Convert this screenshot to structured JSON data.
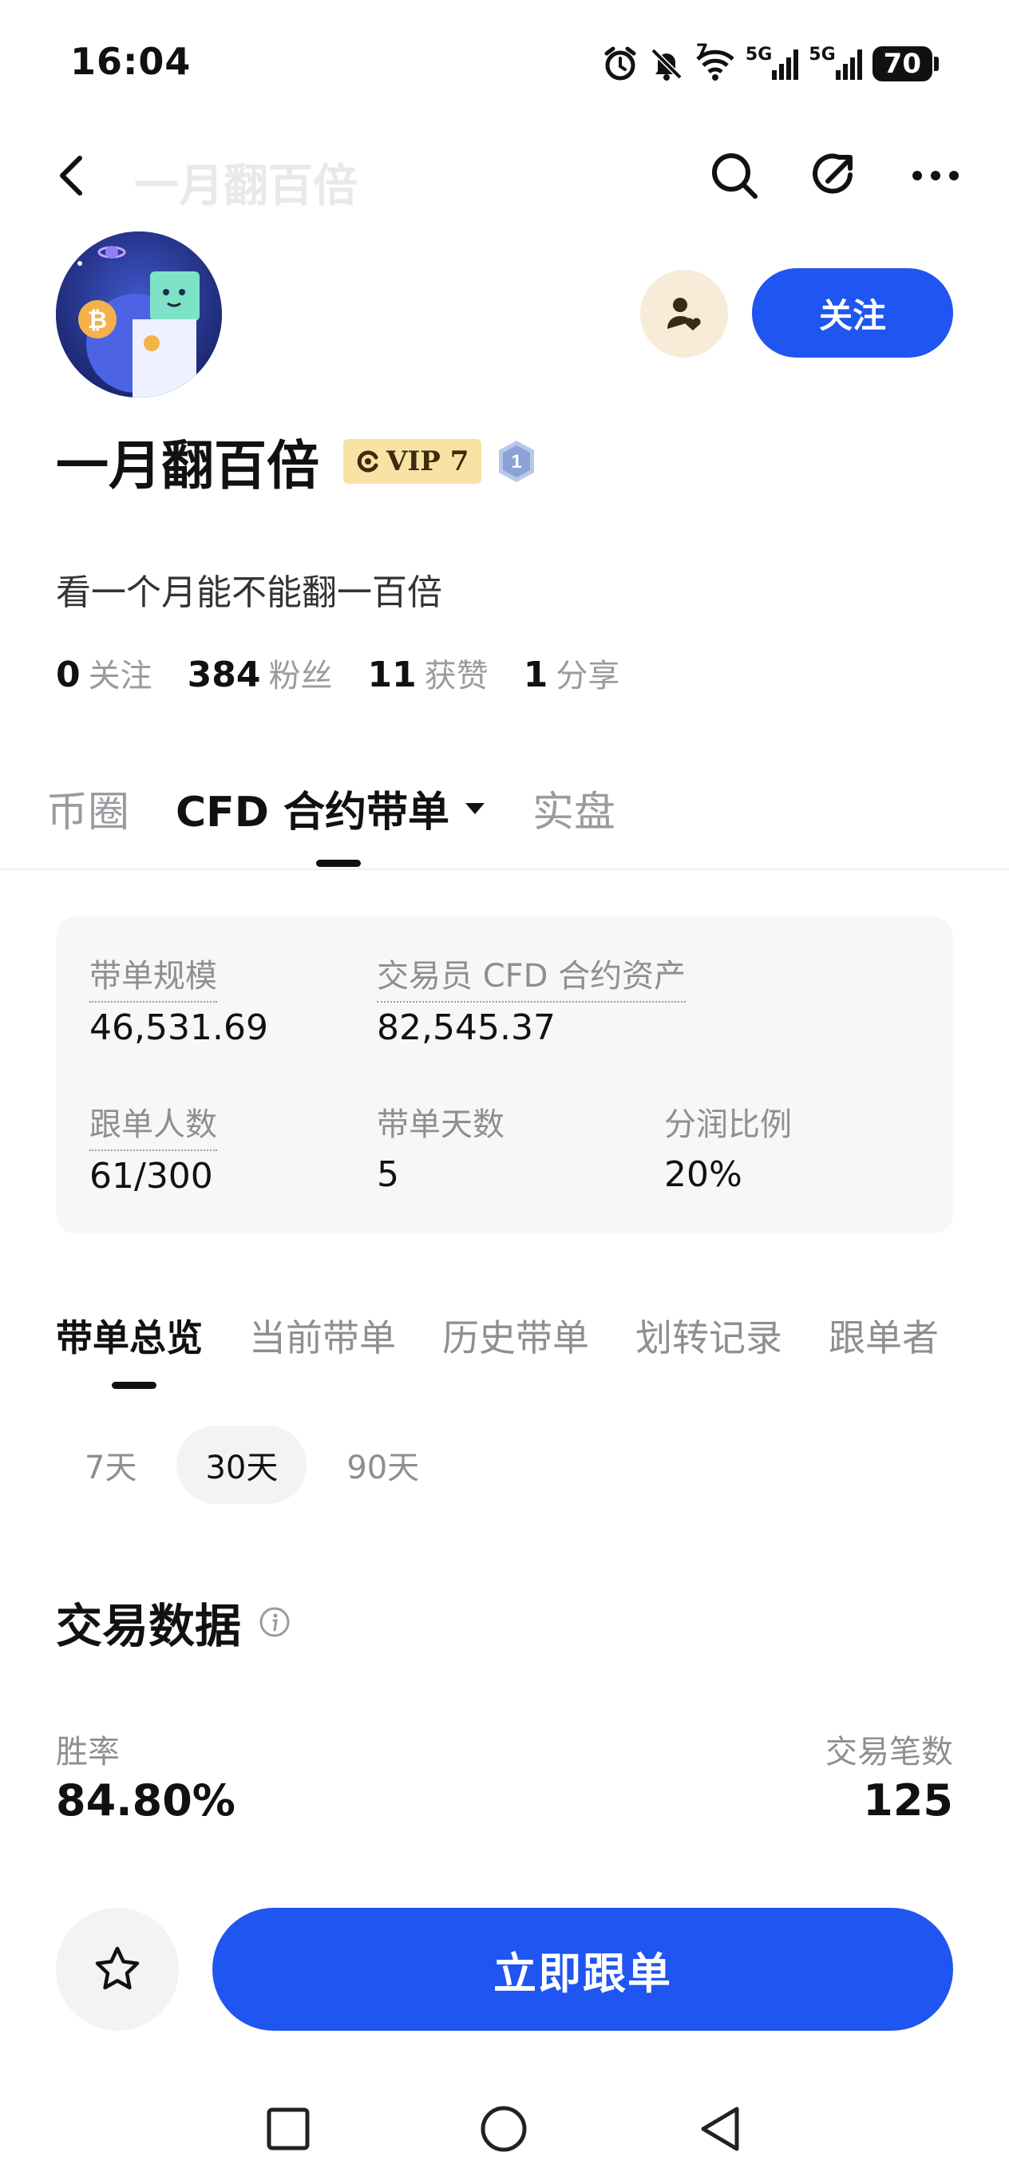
{
  "status_bar": {
    "time": "16:04",
    "net1": "5G",
    "net2": "5G",
    "wifi_badge": "7",
    "battery": "70",
    "icons": [
      "alarm-icon",
      "bell-muted-icon",
      "wifi-icon",
      "signal-icon",
      "signal-icon",
      "battery-icon"
    ]
  },
  "nav": {
    "title": "一月翻百倍",
    "icons": [
      "back-arrow-icon",
      "search-icon",
      "share-icon",
      "more-icon"
    ]
  },
  "profile": {
    "name": "一月翻百倍",
    "vip_badge": "VIP 7",
    "level_badge": "1",
    "bio": "看一个月能不能翻一百倍",
    "follow_button": "关注",
    "stats": [
      {
        "value": "0",
        "label": "关注"
      },
      {
        "value": "384",
        "label": "粉丝"
      },
      {
        "value": "11",
        "label": "获赞"
      },
      {
        "value": "1",
        "label": "分享"
      }
    ]
  },
  "main_tabs": [
    {
      "label": "币圈",
      "active": false
    },
    {
      "label": "CFD 合约带单",
      "active": true
    },
    {
      "label": "实盘",
      "active": false
    }
  ],
  "summary_card": {
    "row1": [
      {
        "label": "带单规模",
        "value": "46,531.69"
      },
      {
        "label": "交易员 CFD 合约资产",
        "value": "82,545.37"
      }
    ],
    "row2": [
      {
        "label": "跟单人数",
        "value": "61/300"
      },
      {
        "label": "带单天数",
        "value": "5"
      },
      {
        "label": "分润比例",
        "value": "20%"
      }
    ]
  },
  "sub_tabs": [
    {
      "label": "带单总览",
      "active": true
    },
    {
      "label": "当前带单",
      "active": false
    },
    {
      "label": "历史带单",
      "active": false
    },
    {
      "label": "划转记录",
      "active": false
    },
    {
      "label": "跟单者",
      "active": false
    }
  ],
  "periods": [
    {
      "label": "7天",
      "active": false
    },
    {
      "label": "30天",
      "active": true
    },
    {
      "label": "90天",
      "active": false
    }
  ],
  "trading_data": {
    "title": "交易数据",
    "win_rate_label": "胜率",
    "win_rate": "84.80%",
    "trade_count_label": "交易笔数",
    "trade_count": "125"
  },
  "actions": {
    "copy_button": "立即跟单"
  },
  "colors": {
    "primary": "#1f55f0",
    "vip_gold": "#f8e3a4",
    "muted": "#8e8e93"
  }
}
